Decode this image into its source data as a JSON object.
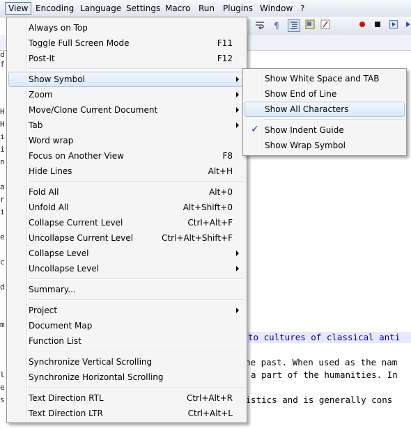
{
  "menubar": {
    "items": [
      "View",
      "Encoding",
      "Language",
      "Settings",
      "Macro",
      "Run",
      "Plugins",
      "Window",
      "?"
    ]
  },
  "editor": {
    "lines": [
      "to cultures of classical anti",
      "he past. When used as the nam",
      "d a part of the humanities. In",
      "uistics and is generally cons"
    ],
    "gutter_chars": [
      "d",
      "f",
      "H",
      "H",
      "i",
      "i",
      "n",
      "a",
      "r",
      "i",
      "e",
      "c",
      "d",
      "m",
      "l",
      "e",
      "s"
    ]
  },
  "view_menu": {
    "items": [
      {
        "label": "Always on Top",
        "shortcut": ""
      },
      {
        "label": "Toggle Full Screen Mode",
        "shortcut": "F11"
      },
      {
        "label": "Post-It",
        "shortcut": "F12"
      },
      {
        "label": "Show Symbol",
        "shortcut": "",
        "submenu": true
      },
      {
        "label": "Zoom",
        "shortcut": "",
        "submenu": true
      },
      {
        "label": "Move/Clone Current Document",
        "shortcut": "",
        "submenu": true
      },
      {
        "label": "Tab",
        "shortcut": "",
        "submenu": true
      },
      {
        "label": "Word wrap",
        "shortcut": ""
      },
      {
        "label": "Focus on Another View",
        "shortcut": "F8"
      },
      {
        "label": "Hide Lines",
        "shortcut": "Alt+H"
      },
      {
        "label": "Fold All",
        "shortcut": "Alt+0"
      },
      {
        "label": "Unfold All",
        "shortcut": "Alt+Shift+0"
      },
      {
        "label": "Collapse Current Level",
        "shortcut": "Ctrl+Alt+F"
      },
      {
        "label": "Uncollapse Current Level",
        "shortcut": "Ctrl+Alt+Shift+F"
      },
      {
        "label": "Collapse Level",
        "shortcut": "",
        "submenu": true
      },
      {
        "label": "Uncollapse Level",
        "shortcut": "",
        "submenu": true
      },
      {
        "label": "Summary...",
        "shortcut": ""
      },
      {
        "label": "Project",
        "shortcut": "",
        "submenu": true
      },
      {
        "label": "Document Map",
        "shortcut": ""
      },
      {
        "label": "Function List",
        "shortcut": ""
      },
      {
        "label": "Synchronize Vertical Scrolling",
        "shortcut": ""
      },
      {
        "label": "Synchronize Horizontal Scrolling",
        "shortcut": ""
      },
      {
        "label": "Text Direction RTL",
        "shortcut": "Ctrl+Alt+R"
      },
      {
        "label": "Text Direction LTR",
        "shortcut": "Ctrl+Alt+L"
      }
    ]
  },
  "symbol_submenu": {
    "items": [
      {
        "label": "Show White Space and TAB",
        "checked": false
      },
      {
        "label": "Show End of Line",
        "checked": false
      },
      {
        "label": "Show All Characters",
        "checked": false
      },
      {
        "label": "Show Indent Guide",
        "checked": true
      },
      {
        "label": "Show Wrap Symbol",
        "checked": false
      }
    ],
    "check_glyph": "✓"
  },
  "toolbar": {
    "icons": [
      "wrap-icon",
      "pilcrow-icon",
      "indent-guide-icon",
      "document-map-icon",
      "function-list-icon",
      "record-macro-icon",
      "stop-macro-icon",
      "play-macro-icon",
      "run-macro-icon"
    ]
  },
  "colors": {
    "menu_bg": "#f5f5f5",
    "highlight_border": "#a8c6ec",
    "check": "#0d3f9f"
  }
}
